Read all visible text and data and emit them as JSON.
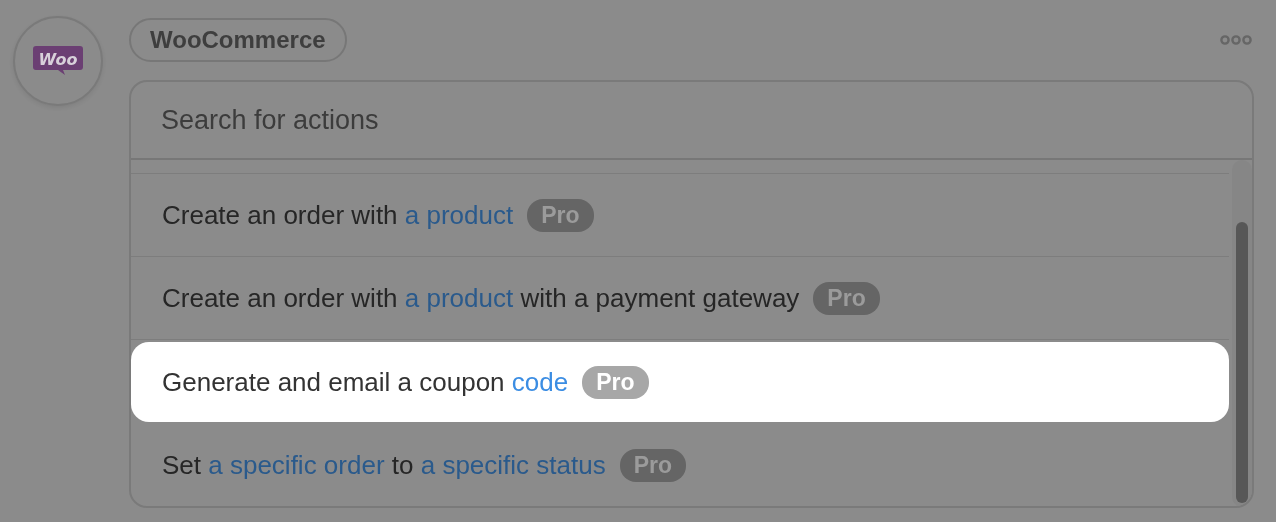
{
  "app": {
    "logo_text": "Woo",
    "name": "WooCommerce"
  },
  "search": {
    "placeholder": "Search for actions"
  },
  "actions": [
    {
      "parts": [
        {
          "kind": "text",
          "text": "Create an order with "
        },
        {
          "kind": "field",
          "text": "a product"
        }
      ],
      "badge": "Pro",
      "selected": false
    },
    {
      "parts": [
        {
          "kind": "text",
          "text": "Create an order with "
        },
        {
          "kind": "field",
          "text": "a product"
        },
        {
          "kind": "text",
          "text": " with a payment gateway"
        }
      ],
      "badge": "Pro",
      "selected": false
    },
    {
      "parts": [
        {
          "kind": "text",
          "text": "Generate and email a coupon "
        },
        {
          "kind": "field",
          "text": "code"
        }
      ],
      "badge": "Pro",
      "selected": true
    },
    {
      "parts": [
        {
          "kind": "text",
          "text": "Set "
        },
        {
          "kind": "field",
          "text": "a specific order"
        },
        {
          "kind": "text",
          "text": " to "
        },
        {
          "kind": "field",
          "text": "a specific status"
        }
      ],
      "badge": "Pro",
      "selected": false
    }
  ]
}
